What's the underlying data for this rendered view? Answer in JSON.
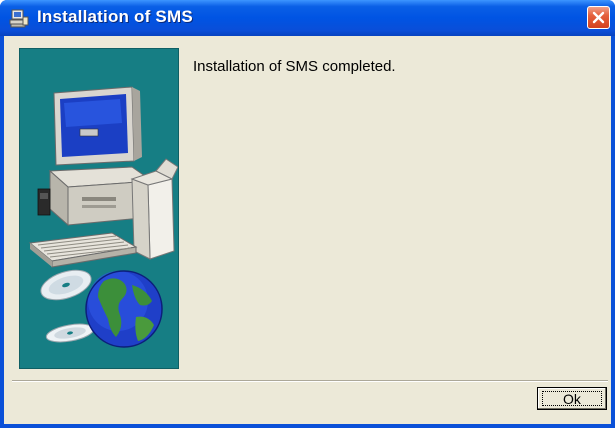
{
  "window": {
    "title": "Installation of SMS",
    "title_icon": "setup-computer-icon",
    "close_icon": "close-icon"
  },
  "content": {
    "message": "Installation of SMS completed.",
    "illustration": [
      "computer-illustration",
      "cd-disc-illustration",
      "globe-illustration"
    ]
  },
  "buttons": {
    "ok_label": "Ok"
  },
  "colors": {
    "titlebar": "#0054e3",
    "client_bg": "#ece9d8",
    "side_panel": "#167e84",
    "close_button": "#e5603c"
  }
}
